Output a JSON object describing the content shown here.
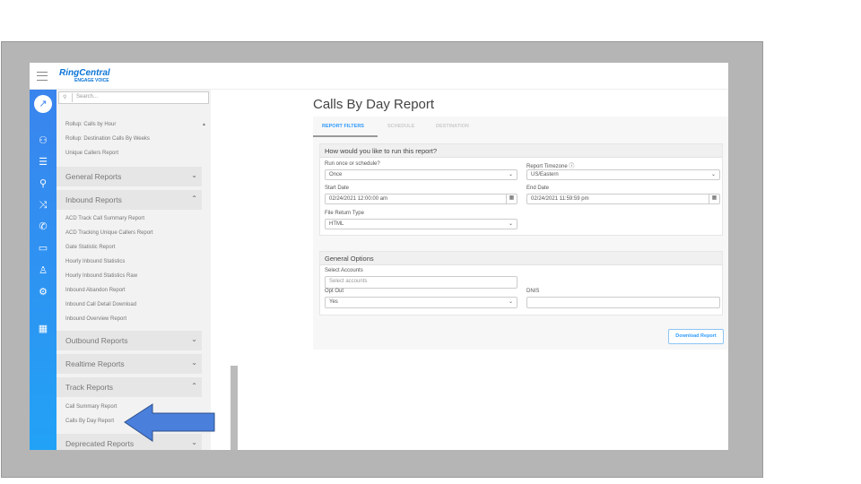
{
  "header": {
    "logo_main": "RingCentral",
    "logo_sub": "ENGAGE VOICE"
  },
  "search": {
    "placeholder": "Search..."
  },
  "nav": {
    "top_items": [
      "Rollup: Calls by Hour",
      "Rollup: Destination Calls By Weeks",
      "Unique Callers Report"
    ],
    "sections": {
      "general": "General Reports",
      "inbound": "Inbound Reports",
      "outbound": "Outbound Reports",
      "realtime": "Realtime Reports",
      "track": "Track Reports",
      "deprecated": "Deprecated Reports"
    },
    "inbound_items": [
      "ACD Track Call Summary Report",
      "ACD Tracking Unique Callers Report",
      "Gate Statistic Report",
      "Hourly Inbound Statistics",
      "Hourly Inbound Statistics Raw",
      "Inbound Abandon Report",
      "Inbound Call Detail Download",
      "Inbound Overview Report"
    ],
    "track_items": [
      "Call Summary Report",
      "Calls By Day Report"
    ]
  },
  "page": {
    "title": "Calls By Day Report",
    "tabs": [
      "REPORT FILTERS",
      "SCHEDULE",
      "DESTINATION"
    ],
    "card1": {
      "title": "How would you like to run this report?",
      "run_label": "Run once or schedule?",
      "run_value": "Once",
      "tz_label": "Report Timezone",
      "tz_value": "US/Eastern",
      "start_label": "Start Date",
      "start_value": "02/24/2021 12:00:00 am",
      "end_label": "End Date",
      "end_value": "02/24/2021 11:59:59 pm",
      "file_label": "File Return Type",
      "file_value": "HTML"
    },
    "card2": {
      "title": "General Options",
      "accounts_label": "Select Accounts",
      "accounts_placeholder": "Select accounts",
      "optout_label": "Opt Out",
      "optout_value": "Yes",
      "dnis_label": "DNIS",
      "dnis_value": ""
    },
    "download_label": "Download Report"
  },
  "colors": {
    "accent": "#2f9bff",
    "rail": "#3a84ee",
    "arrow": "#4a7fdc"
  }
}
